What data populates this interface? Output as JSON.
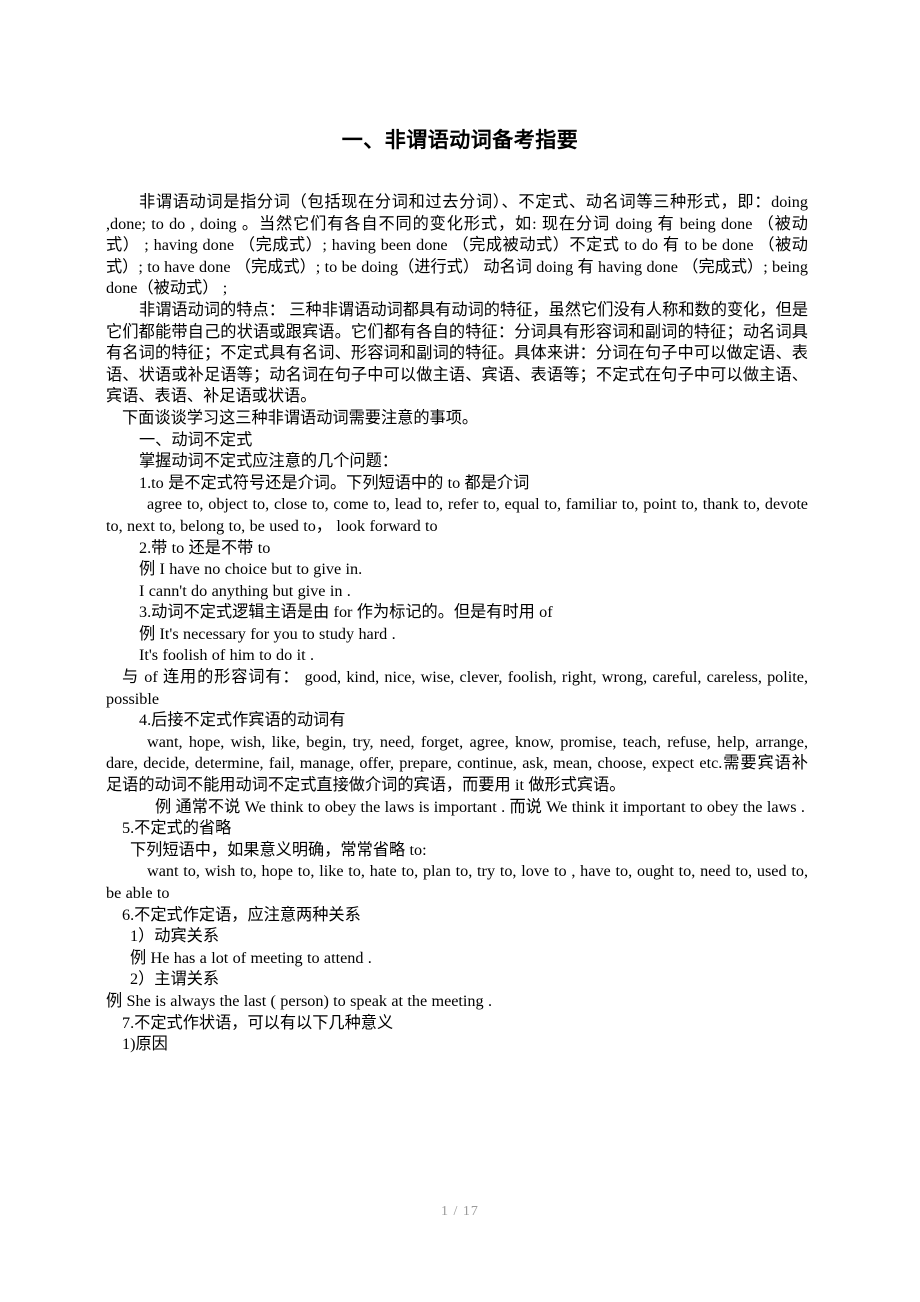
{
  "document": {
    "title": "一、非谓语动词备考指要",
    "page_footer": "1 / 17"
  },
  "content": {
    "para_intro": "非谓语动词是指分词（包括现在分词和过去分词）、不定式、动名词等三种形式，即：doing ,done; to do , doing 。当然它们有各自不同的变化形式，如: 现在分词   doing   有 being done （被动式）  ; having done （完成式）; having been done （完成被动式）不定式   to do 有 to be done （被动式）; to have done （完成式）; to be doing（进行式） 动名词 doing   有 having   done （完成式）; being done（被动式）  ;",
    "para_features": "非谓语动词的特点： 三种非谓语动词都具有动词的特征，虽然它们没有人称和数的变化，但是它们都能带自己的状语或跟宾语。它们都有各自的特征：分词具有形容词和副词的特征；动名词具有名词的特征；不定式具有名词、形容词和副词的特征。具体来讲：分词在句子中可以做定语、表语、状语或补足语等；动名词在句子中可以做主语、宾语、表语等；不定式在句子中可以做主语、宾语、表语、补足语或状语。",
    "para_lead": "下面谈谈学习这三种非谓语动词需要注意的事项。",
    "section_heading": "一、动词不定式",
    "section_subheading": "掌握动词不定式应注意的几个问题：",
    "item1_heading": "1.to 是不定式符号还是介词。下列短语中的 to 都是介词",
    "item1_list": "agree to, object to, close to,   come to,   lead to,   refer to, equal to,   familiar to, point to, thank to, devote to, next to, belong to, be used to，   look forward to",
    "item2_heading": "2.带 to 还是不带 to",
    "item2_example1": "例  I have no choice but to give in.",
    "item2_example2": "I cann't do anything but give in .",
    "item3_heading": "3.动词不定式逻辑主语是由 for 作为标记的。但是有时用 of",
    "item3_example1": "例  It's necessary for you to study hard .",
    "item3_example2": "It's foolish of him to do it .",
    "item3_of_list": "与 of 连用的形容词有：  good, kind, nice, wise, clever, foolish, right, wrong, careful, careless, polite, possible",
    "item4_heading": "4.后接不定式作宾语的动词有",
    "item4_list": "want, hope, wish, like, begin, try, need, forget, agree, know, promise, teach, refuse, help, arrange, dare, decide, determine, fail, manage, offer, prepare, continue, ask, mean, choose, expect etc.需要宾语补足语的动词不能用动词不定式直接做介词的宾语，而要用 it 做形式宾语。",
    "item4_example": "例  通常不说 We think to obey the laws is important . 而说 We think it important to obey the laws .",
    "item5_heading": "5.不定式的省略",
    "item5_intro": "下列短语中，如果意义明确，常常省略 to:",
    "item5_list": "want to, wish to, hope to, like to, hate to, plan to, try to, love to , have    to, ought to, need to, used to, be able to",
    "item6_heading": "6.不定式作定语，应注意两种关系",
    "item6_sub1": "1）动宾关系",
    "item6_example1": "例  He has a lot of meeting to attend .",
    "item6_sub2": "2）主谓关系",
    "item6_example2": "例  She is always the last ( person) to speak at the meeting .",
    "item7_heading": "7.不定式作状语，可以有以下几种意义",
    "item7_sub1": "1)原因"
  }
}
